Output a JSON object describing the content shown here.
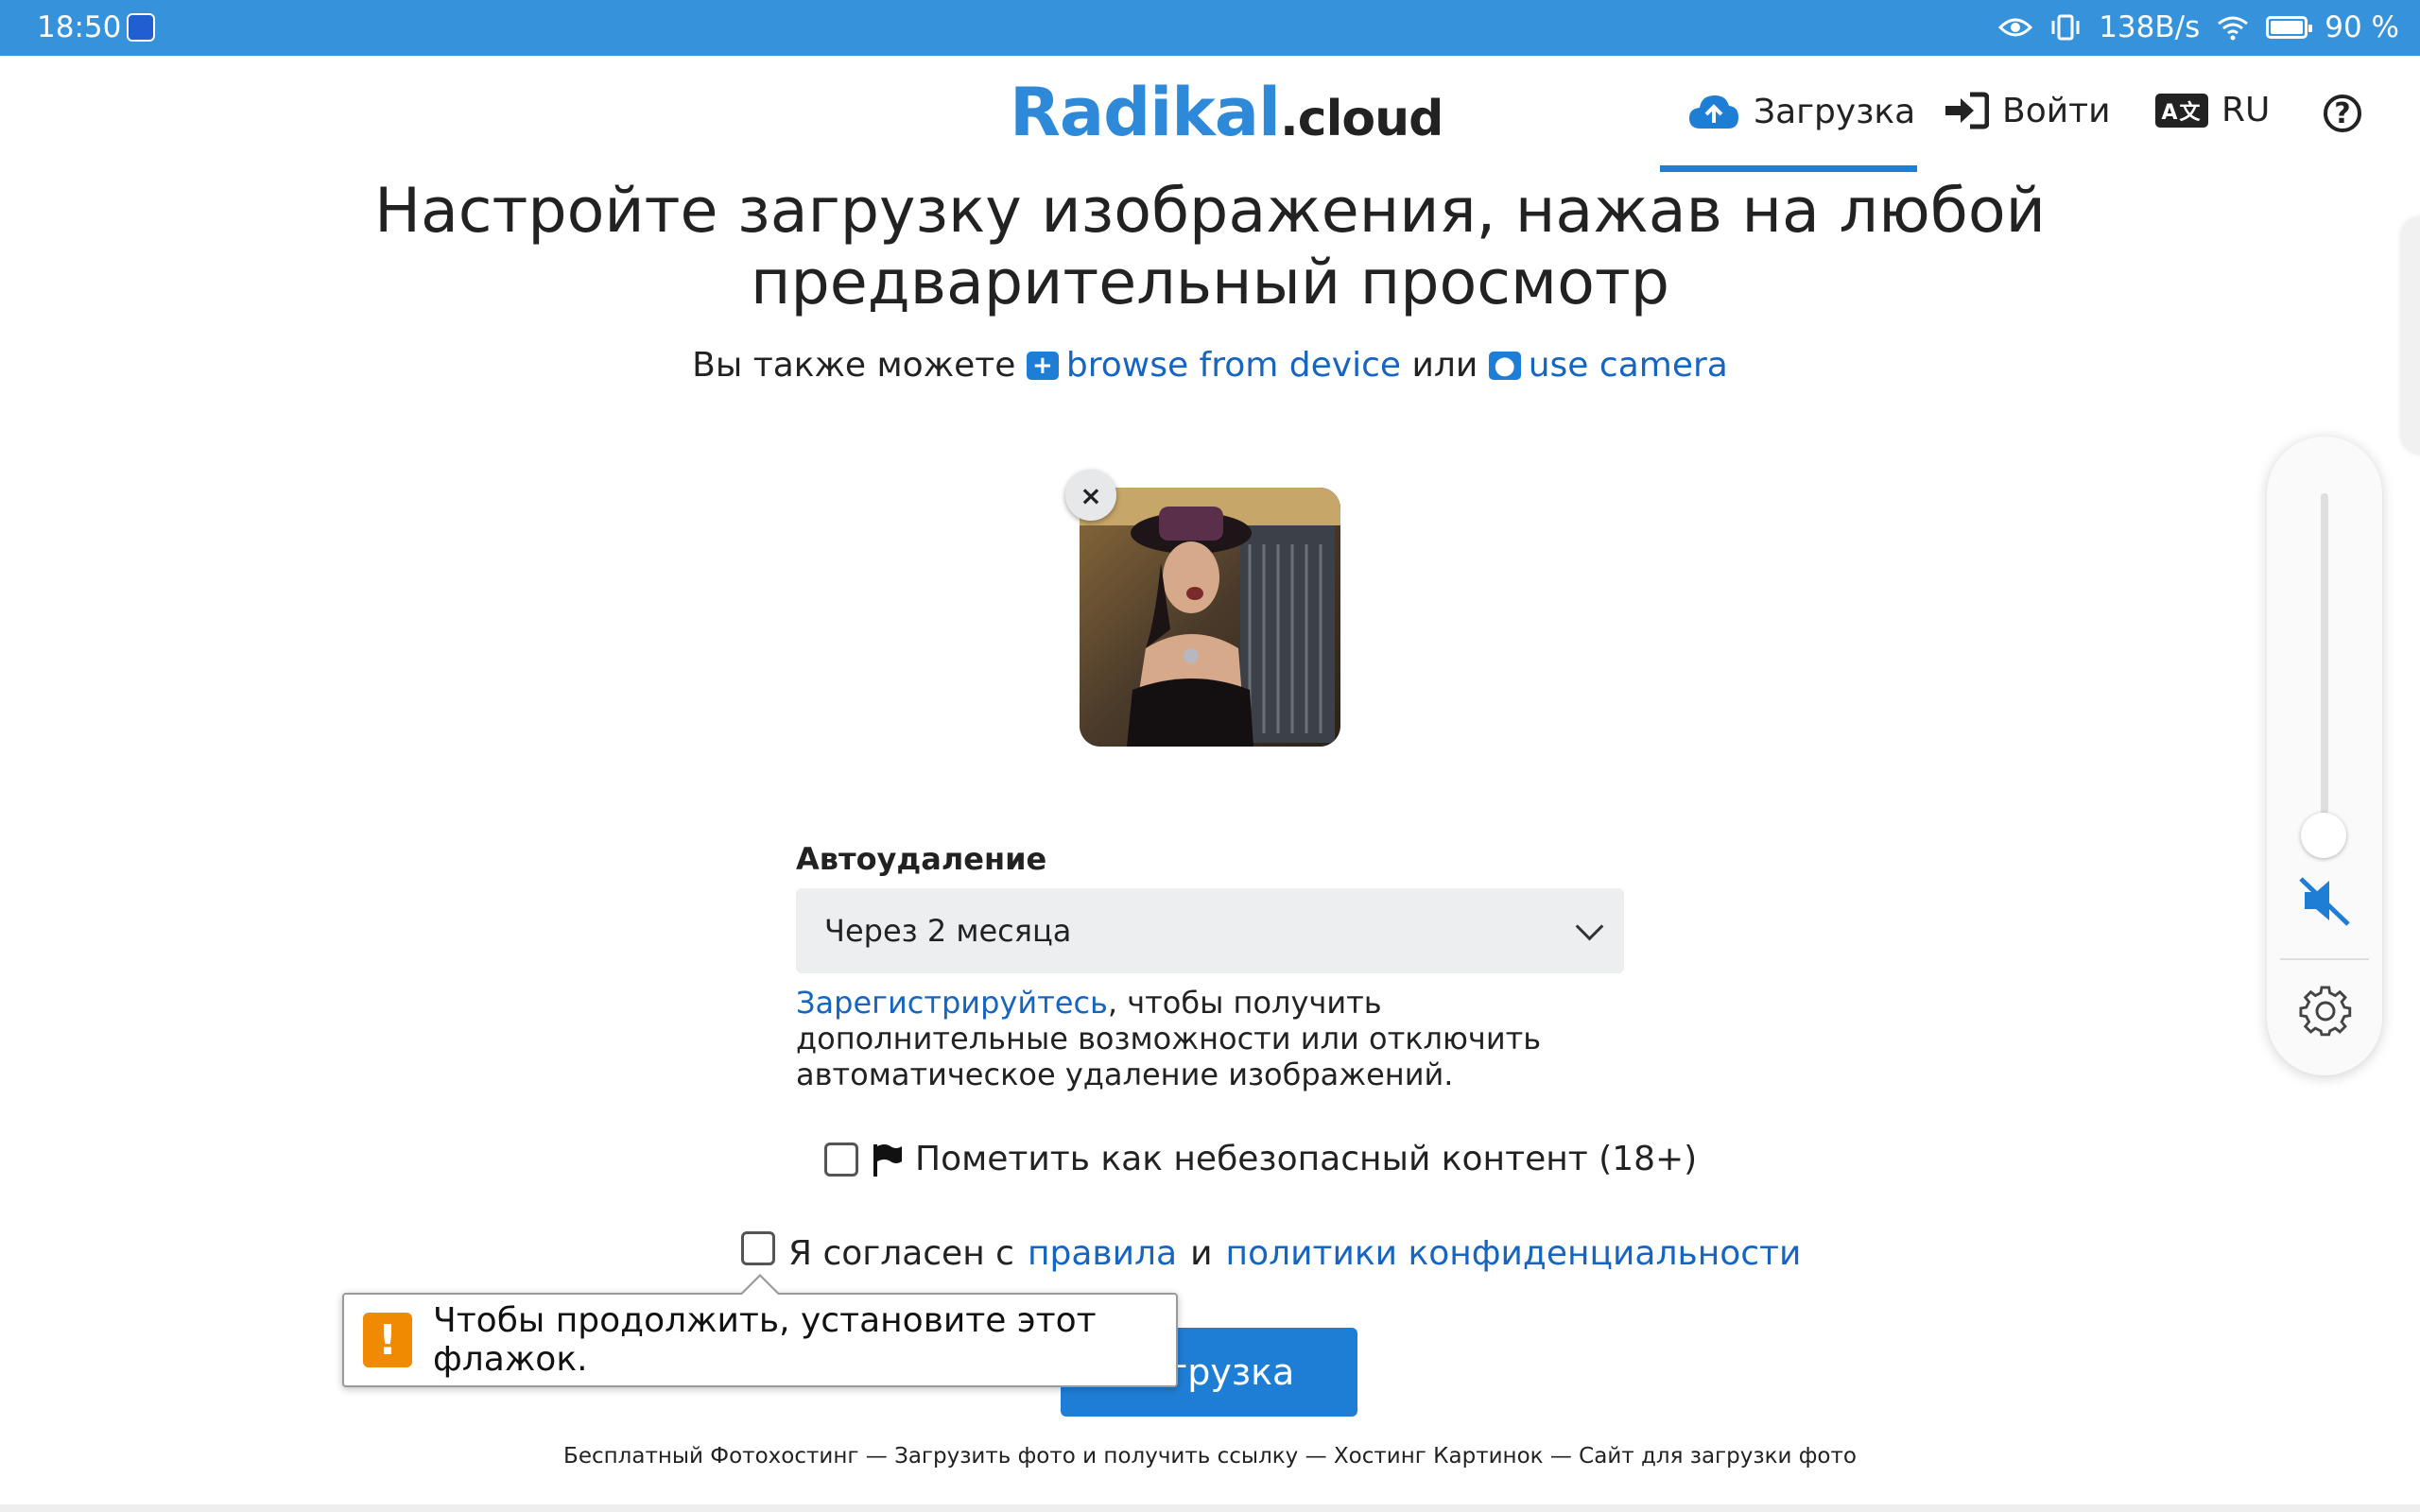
{
  "status_bar": {
    "time": "18:50",
    "speed": "138B/s",
    "battery": "90 %",
    "icons": [
      "bulb-notification-icon",
      "eye-icon",
      "vibrate-icon",
      "wifi-icon",
      "battery-icon"
    ]
  },
  "header": {
    "logo_main": "Radikal",
    "logo_suffix": ".cloud",
    "nav": {
      "upload": "Загрузка",
      "login": "Войти",
      "lang_icon_text": "A文",
      "lang": "RU",
      "help": "?"
    }
  },
  "main": {
    "title": "Настройте загрузку изображения, нажав на любой предварительный просмотр",
    "sub_prefix": "Вы также можете",
    "browse": "browse from device",
    "or": "или",
    "camera": "use camera",
    "close_label": "×"
  },
  "form": {
    "autodelete_label": "Автоудаление",
    "autodelete_value": "Через 2 месяца",
    "register_link": "Зарегистрируйтесь",
    "register_text": ", чтобы получить дополнительные возможности или отключить автоматическое удаление изображений.",
    "nsfw_label": "Пометить как небезопасный контент (18+)",
    "agree_prefix": "Я согласен с",
    "rules_link": "правила",
    "and": "и",
    "privacy_link": "политики конфиденциальности",
    "upload_button": "Загрузка"
  },
  "tooltip": {
    "icon": "!",
    "text": "Чтобы продолжить, установите этот флажок."
  },
  "footer": {
    "text": "Бесплатный Фотохостинг — Загрузить фото и получить ссылку — Хостинг Картинок — Сайт для загрузки фото"
  },
  "colors": {
    "status_bar": "#3693db",
    "accent": "#1e7ed6",
    "link": "#1665c0",
    "warning": "#f08a00"
  }
}
